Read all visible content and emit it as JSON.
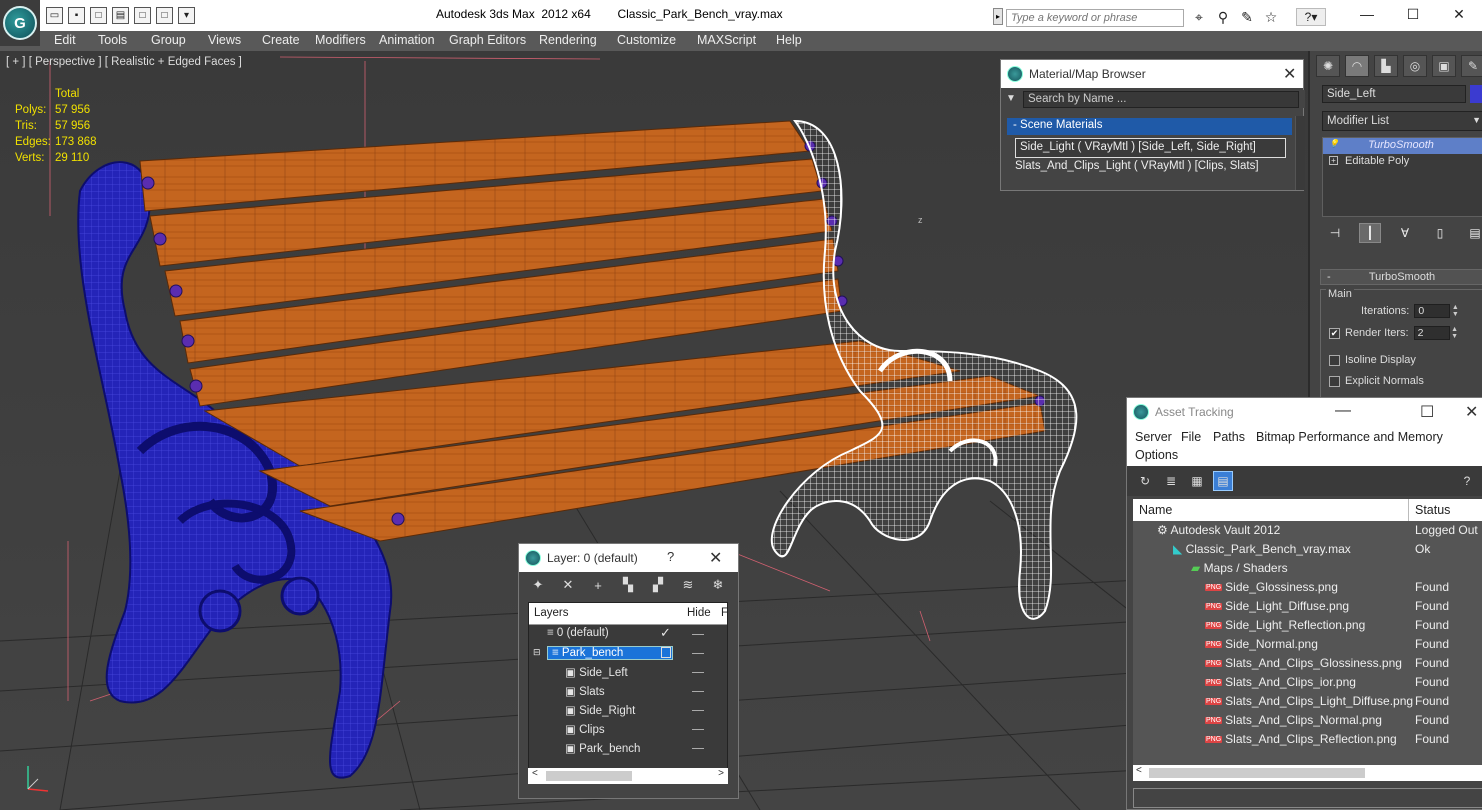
{
  "title": {
    "app": "Autodesk 3ds Max  2012 x64",
    "file": "Classic_Park_Bench_vray.max",
    "search_placeholder": "Type a keyword or phrase",
    "help": "?"
  },
  "menu": [
    "Edit",
    "Tools",
    "Group",
    "Views",
    "Create",
    "Modifiers",
    "Animation",
    "Graph Editors",
    "Rendering",
    "Customize",
    "MAXScript",
    "Help"
  ],
  "viewport": {
    "label": "[ + ] [ Perspective ] [ Realistic + Edged Faces ]",
    "stats_header": "Total",
    "stats": [
      {
        "k": "Polys:",
        "v": "57 956"
      },
      {
        "k": "Tris:",
        "v": "57 956"
      },
      {
        "k": "Edges:",
        "v": "173 868"
      },
      {
        "k": "Verts:",
        "v": "29 110"
      }
    ]
  },
  "command_panel": {
    "object_name": "Side_Left",
    "modifier_list": "Modifier List",
    "stack": [
      {
        "label": "TurboSmooth",
        "selected": true
      },
      {
        "label": "Editable Poly",
        "selected": false
      }
    ],
    "rollout": {
      "title": "TurboSmooth",
      "group": "Main",
      "iterations_label": "Iterations:",
      "iterations": "0",
      "render_iters_label": "Render Iters:",
      "render_iters": "2",
      "isoline": "Isoline Display",
      "explicit": "Explicit Normals"
    }
  },
  "material_browser": {
    "title": "Material/Map Browser",
    "search": "Search by Name ...",
    "section": "- Scene Materials",
    "items": [
      "Side_Light  ( VRayMtl ) [Side_Left, Side_Right]",
      "Slats_And_Clips_Light ( VRayMtl ) [Clips, Slats]"
    ]
  },
  "layers": {
    "title": "Layer: 0 (default)",
    "help": "?",
    "col_layers": "Layers",
    "col_hide": "Hide",
    "col_f": "F",
    "rows": [
      {
        "name": "0 (default)",
        "indent": 0
      },
      {
        "name": "Park_bench",
        "indent": 0
      },
      {
        "name": "Side_Left",
        "indent": 1
      },
      {
        "name": "Slats",
        "indent": 1
      },
      {
        "name": "Side_Right",
        "indent": 1
      },
      {
        "name": "Clips",
        "indent": 1
      },
      {
        "name": "Park_bench",
        "indent": 1
      }
    ]
  },
  "assets": {
    "title": "Asset Tracking",
    "menu": [
      "Server",
      "File",
      "Paths",
      "Bitmap Performance and Memory",
      "Options"
    ],
    "col_name": "Name",
    "col_status": "Status",
    "png": "PNG",
    "rows": [
      {
        "name": "Autodesk Vault 2012",
        "status": "Logged Out ...",
        "level": 0
      },
      {
        "name": "Classic_Park_Bench_vray.max",
        "status": "Ok",
        "level": 1
      },
      {
        "name": "Maps / Shaders",
        "status": "",
        "level": 2
      },
      {
        "name": "Side_Glossiness.png",
        "status": "Found",
        "level": 3
      },
      {
        "name": "Side_Light_Diffuse.png",
        "status": "Found",
        "level": 3
      },
      {
        "name": "Side_Light_Reflection.png",
        "status": "Found",
        "level": 3
      },
      {
        "name": "Side_Normal.png",
        "status": "Found",
        "level": 3
      },
      {
        "name": "Slats_And_Clips_Glossiness.png",
        "status": "Found",
        "level": 3
      },
      {
        "name": "Slats_And_Clips_ior.png",
        "status": "Found",
        "level": 3
      },
      {
        "name": "Slats_And_Clips_Light_Diffuse.png",
        "status": "Found",
        "level": 3
      },
      {
        "name": "Slats_And_Clips_Normal.png",
        "status": "Found",
        "level": 3
      },
      {
        "name": "Slats_And_Clips_Reflection.png",
        "status": "Found",
        "level": 3
      }
    ]
  },
  "colors": {
    "wood": "#c4651f",
    "left_leg": "#1d1db0",
    "right_leg": "#ffffff",
    "selection": "#1a73d9"
  }
}
